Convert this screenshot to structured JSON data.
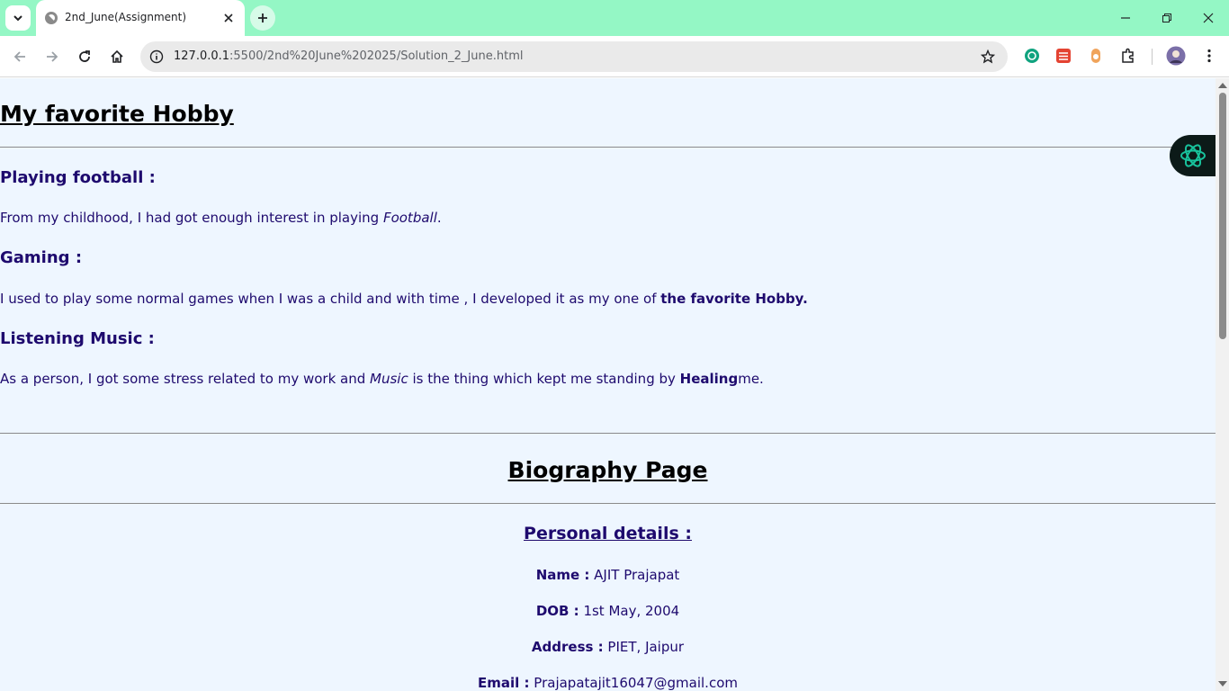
{
  "browser": {
    "tab_title": "2nd_June(Assignment)",
    "url_host": "127.0.0.1",
    "url_path": ":5500/2nd%20June%202025/Solution_2_June.html",
    "accent_color": "#94f7c5"
  },
  "page": {
    "hobby_title": "My favorite Hobby",
    "sections": [
      {
        "heading": "Playing football :",
        "text_before": "From my childhood, I had got enough interest in playing ",
        "emphasis": "Football",
        "text_after": "."
      },
      {
        "heading": "Gaming :",
        "text_before": "I used to play some normal games when I was a child and with time , I developed it as my one of ",
        "strong": "the favorite Hobby."
      },
      {
        "heading": "Listening Music :",
        "text_before": "As a person, I got some stress related to my work and ",
        "emphasis": "Music",
        "text_middle": " is the thing which kept me standing by ",
        "strong": "Healing",
        "text_after": "me."
      }
    ],
    "bio_title": "Biography Page",
    "personal_heading": "Personal details :",
    "details": [
      {
        "label": "Name :",
        "value": " AJIT Prajapat"
      },
      {
        "label": "DOB :",
        "value": " 1st May, 2004"
      },
      {
        "label": "Address :",
        "value": " PIET, Jaipur"
      },
      {
        "label": "Email :",
        "value": " Prajapatajit16047@gmail.com"
      }
    ],
    "text_color": "#1e0a6e",
    "background_color": "#eef6ff"
  }
}
